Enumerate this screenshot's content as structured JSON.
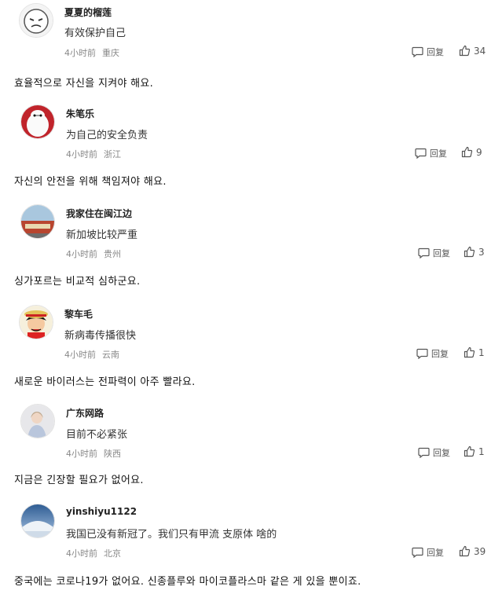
{
  "labels": {
    "reply": "回复"
  },
  "comments": [
    {
      "user": "夏夏的榴莲",
      "text": "有效保护自己",
      "time": "4小时前",
      "location": "重庆",
      "likes": "34",
      "avatar_icon": "cartoon-face-icon",
      "translation": "효율적으로 자신을 지켜야 해요."
    },
    {
      "user": "朱笔乐",
      "text": "为自己的安全负责",
      "time": "4小时前",
      "location": "浙江",
      "likes": "9",
      "avatar_icon": "robot-character-icon",
      "translation": "자신의 안전을 위해 책임져야 해요."
    },
    {
      "user": "我家住在闽江边",
      "text": "新加坡比较严重",
      "time": "4小时前",
      "location": "贵州",
      "likes": "3",
      "avatar_icon": "building-photo-icon",
      "translation": "싱가포르는 비교적 심하군요."
    },
    {
      "user": "黎车毛",
      "text": "新病毒传播很快",
      "time": "4小时前",
      "location": "云南",
      "likes": "1",
      "avatar_icon": "anime-character-icon",
      "translation": "새로운 바이러스는 전파력이 아주 빨라요."
    },
    {
      "user": "广东网路",
      "text": "目前不必紧张",
      "time": "4小时前",
      "location": "陕西",
      "likes": "1",
      "avatar_icon": "girl-photo-icon",
      "translation": "지금은 긴장할 필요가 없어요."
    },
    {
      "user": "yinshiyu1122",
      "text": "我国已没有新冠了。我们只有甲流 支原体 啥的",
      "time": "4小时前",
      "location": "北京",
      "likes": "39",
      "avatar_icon": "landscape-photo-icon",
      "translation": "중국에는 코로나19가 없어요. 신종플루와 마이코플라스마 같은 게 있을 뿐이죠."
    }
  ]
}
